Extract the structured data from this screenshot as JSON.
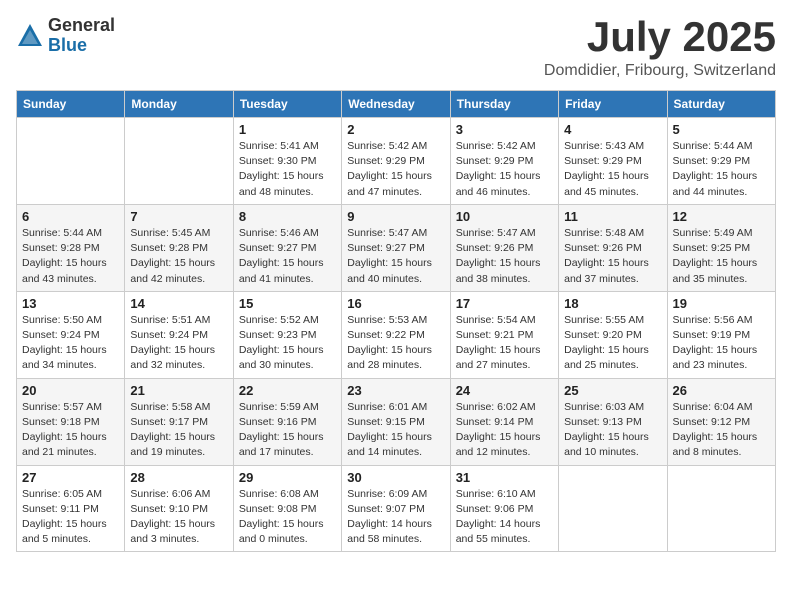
{
  "logo": {
    "general": "General",
    "blue": "Blue"
  },
  "title": "July 2025",
  "subtitle": "Domdidier, Fribourg, Switzerland",
  "weekdays": [
    "Sunday",
    "Monday",
    "Tuesday",
    "Wednesday",
    "Thursday",
    "Friday",
    "Saturday"
  ],
  "weeks": [
    [
      {
        "day": "",
        "info": ""
      },
      {
        "day": "",
        "info": ""
      },
      {
        "day": "1",
        "info": "Sunrise: 5:41 AM\nSunset: 9:30 PM\nDaylight: 15 hours\nand 48 minutes."
      },
      {
        "day": "2",
        "info": "Sunrise: 5:42 AM\nSunset: 9:29 PM\nDaylight: 15 hours\nand 47 minutes."
      },
      {
        "day": "3",
        "info": "Sunrise: 5:42 AM\nSunset: 9:29 PM\nDaylight: 15 hours\nand 46 minutes."
      },
      {
        "day": "4",
        "info": "Sunrise: 5:43 AM\nSunset: 9:29 PM\nDaylight: 15 hours\nand 45 minutes."
      },
      {
        "day": "5",
        "info": "Sunrise: 5:44 AM\nSunset: 9:29 PM\nDaylight: 15 hours\nand 44 minutes."
      }
    ],
    [
      {
        "day": "6",
        "info": "Sunrise: 5:44 AM\nSunset: 9:28 PM\nDaylight: 15 hours\nand 43 minutes."
      },
      {
        "day": "7",
        "info": "Sunrise: 5:45 AM\nSunset: 9:28 PM\nDaylight: 15 hours\nand 42 minutes."
      },
      {
        "day": "8",
        "info": "Sunrise: 5:46 AM\nSunset: 9:27 PM\nDaylight: 15 hours\nand 41 minutes."
      },
      {
        "day": "9",
        "info": "Sunrise: 5:47 AM\nSunset: 9:27 PM\nDaylight: 15 hours\nand 40 minutes."
      },
      {
        "day": "10",
        "info": "Sunrise: 5:47 AM\nSunset: 9:26 PM\nDaylight: 15 hours\nand 38 minutes."
      },
      {
        "day": "11",
        "info": "Sunrise: 5:48 AM\nSunset: 9:26 PM\nDaylight: 15 hours\nand 37 minutes."
      },
      {
        "day": "12",
        "info": "Sunrise: 5:49 AM\nSunset: 9:25 PM\nDaylight: 15 hours\nand 35 minutes."
      }
    ],
    [
      {
        "day": "13",
        "info": "Sunrise: 5:50 AM\nSunset: 9:24 PM\nDaylight: 15 hours\nand 34 minutes."
      },
      {
        "day": "14",
        "info": "Sunrise: 5:51 AM\nSunset: 9:24 PM\nDaylight: 15 hours\nand 32 minutes."
      },
      {
        "day": "15",
        "info": "Sunrise: 5:52 AM\nSunset: 9:23 PM\nDaylight: 15 hours\nand 30 minutes."
      },
      {
        "day": "16",
        "info": "Sunrise: 5:53 AM\nSunset: 9:22 PM\nDaylight: 15 hours\nand 28 minutes."
      },
      {
        "day": "17",
        "info": "Sunrise: 5:54 AM\nSunset: 9:21 PM\nDaylight: 15 hours\nand 27 minutes."
      },
      {
        "day": "18",
        "info": "Sunrise: 5:55 AM\nSunset: 9:20 PM\nDaylight: 15 hours\nand 25 minutes."
      },
      {
        "day": "19",
        "info": "Sunrise: 5:56 AM\nSunset: 9:19 PM\nDaylight: 15 hours\nand 23 minutes."
      }
    ],
    [
      {
        "day": "20",
        "info": "Sunrise: 5:57 AM\nSunset: 9:18 PM\nDaylight: 15 hours\nand 21 minutes."
      },
      {
        "day": "21",
        "info": "Sunrise: 5:58 AM\nSunset: 9:17 PM\nDaylight: 15 hours\nand 19 minutes."
      },
      {
        "day": "22",
        "info": "Sunrise: 5:59 AM\nSunset: 9:16 PM\nDaylight: 15 hours\nand 17 minutes."
      },
      {
        "day": "23",
        "info": "Sunrise: 6:01 AM\nSunset: 9:15 PM\nDaylight: 15 hours\nand 14 minutes."
      },
      {
        "day": "24",
        "info": "Sunrise: 6:02 AM\nSunset: 9:14 PM\nDaylight: 15 hours\nand 12 minutes."
      },
      {
        "day": "25",
        "info": "Sunrise: 6:03 AM\nSunset: 9:13 PM\nDaylight: 15 hours\nand 10 minutes."
      },
      {
        "day": "26",
        "info": "Sunrise: 6:04 AM\nSunset: 9:12 PM\nDaylight: 15 hours\nand 8 minutes."
      }
    ],
    [
      {
        "day": "27",
        "info": "Sunrise: 6:05 AM\nSunset: 9:11 PM\nDaylight: 15 hours\nand 5 minutes."
      },
      {
        "day": "28",
        "info": "Sunrise: 6:06 AM\nSunset: 9:10 PM\nDaylight: 15 hours\nand 3 minutes."
      },
      {
        "day": "29",
        "info": "Sunrise: 6:08 AM\nSunset: 9:08 PM\nDaylight: 15 hours\nand 0 minutes."
      },
      {
        "day": "30",
        "info": "Sunrise: 6:09 AM\nSunset: 9:07 PM\nDaylight: 14 hours\nand 58 minutes."
      },
      {
        "day": "31",
        "info": "Sunrise: 6:10 AM\nSunset: 9:06 PM\nDaylight: 14 hours\nand 55 minutes."
      },
      {
        "day": "",
        "info": ""
      },
      {
        "day": "",
        "info": ""
      }
    ]
  ]
}
